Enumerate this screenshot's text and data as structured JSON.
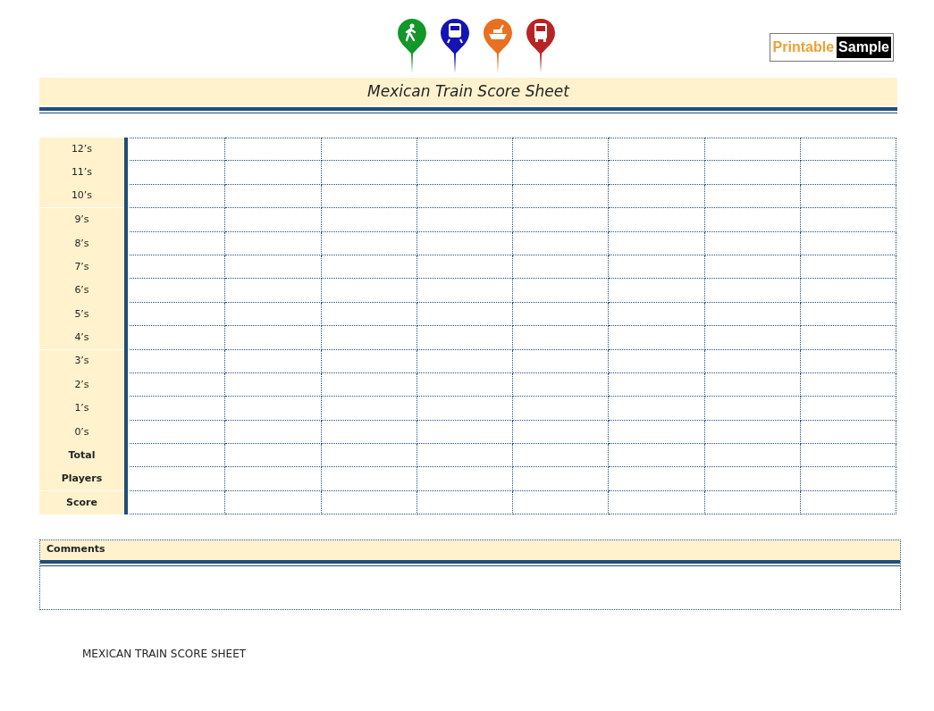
{
  "logo": {
    "first": "Printable",
    "second": "Sample"
  },
  "title": "Mexican Train Score Sheet",
  "rows": [
    {
      "label": "12’s",
      "bold": false,
      "divider": false
    },
    {
      "label": "11’s",
      "bold": false,
      "divider": false
    },
    {
      "label": "10’s",
      "bold": false,
      "divider": true
    },
    {
      "label": "9’s",
      "bold": false,
      "divider": false
    },
    {
      "label": "8’s",
      "bold": false,
      "divider": false
    },
    {
      "label": "7’s",
      "bold": false,
      "divider": false
    },
    {
      "label": "6’s",
      "bold": false,
      "divider": false
    },
    {
      "label": "5’s",
      "bold": false,
      "divider": false
    },
    {
      "label": "4’s",
      "bold": false,
      "divider": true
    },
    {
      "label": "3’s",
      "bold": false,
      "divider": false
    },
    {
      "label": "2’s",
      "bold": false,
      "divider": false
    },
    {
      "label": "1’s",
      "bold": false,
      "divider": false
    },
    {
      "label": "0’s",
      "bold": false,
      "divider": false
    },
    {
      "label": "Total",
      "bold": true,
      "divider": false
    },
    {
      "label": "Players",
      "bold": true,
      "divider": true
    },
    {
      "label": "Score",
      "bold": true,
      "divider": false
    }
  ],
  "comments": {
    "label": "Comments"
  },
  "footer": "MEXICAN TRAIN SCORE SHEET"
}
